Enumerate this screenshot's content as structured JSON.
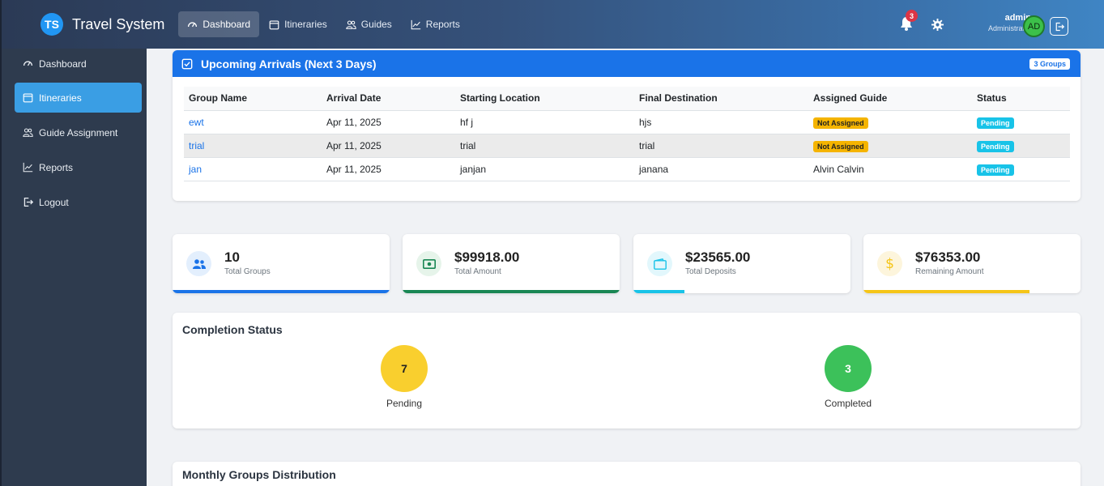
{
  "brand": {
    "logo_text": "TS",
    "name": "Travel System"
  },
  "topnav": [
    {
      "label": "Dashboard",
      "icon": "dashboard-icon",
      "active": true
    },
    {
      "label": "Itineraries",
      "icon": "calendar-icon",
      "active": false
    },
    {
      "label": "Guides",
      "icon": "people-icon",
      "active": false
    },
    {
      "label": "Reports",
      "icon": "chart-icon",
      "active": false
    }
  ],
  "header": {
    "notification_count": "3",
    "user_name": "admin",
    "user_role": "Administrator",
    "avatar_initials": "AD"
  },
  "sidebar": {
    "items": [
      {
        "label": "Dashboard",
        "icon": "dashboard-icon"
      },
      {
        "label": "Itineraries",
        "icon": "calendar-icon",
        "active": true
      },
      {
        "label": "Guide Assignment",
        "icon": "people-icon"
      },
      {
        "label": "Reports",
        "icon": "chart-icon"
      },
      {
        "label": "Logout",
        "icon": "logout-icon"
      }
    ]
  },
  "arrivals": {
    "title": "Upcoming Arrivals (Next 3 Days)",
    "badge": "3 Groups",
    "columns": [
      "Group Name",
      "Arrival Date",
      "Starting Location",
      "Final Destination",
      "Assigned Guide",
      "Status"
    ],
    "rows": [
      {
        "group": "ewt",
        "date": "Apr 11, 2025",
        "start": "hf j",
        "dest": "hjs",
        "guide": "Not Assigned",
        "status": "Pending"
      },
      {
        "group": "trial",
        "date": "Apr 11, 2025",
        "start": "trial",
        "dest": "trial",
        "guide": "Not Assigned",
        "status": "Pending"
      },
      {
        "group": "jan",
        "date": "Apr 11, 2025",
        "start": "janjan",
        "dest": "janana",
        "guide": "Alvin Calvin",
        "status": "Pending"
      }
    ]
  },
  "stats": [
    {
      "value": "10",
      "label": "Total Groups",
      "icon": "people-icon",
      "color": "#1a73e8",
      "progress": 1.0
    },
    {
      "value": "$99918.00",
      "label": "Total Amount",
      "icon": "cash-icon",
      "color": "#198754",
      "progress": 1.0
    },
    {
      "value": "$23565.00",
      "label": "Total Deposits",
      "icon": "wallet-icon",
      "color": "#18c3e8",
      "progress": 0.236
    },
    {
      "value": "$76353.00",
      "label": "Remaining Amount",
      "icon": "dollar-icon",
      "color": "#f5c518",
      "progress": 0.764
    }
  ],
  "completion": {
    "title": "Completion Status",
    "pending": {
      "value": "7",
      "label": "Pending",
      "color": "#f9cf2e"
    },
    "completed": {
      "value": "3",
      "label": "Completed",
      "color": "#3cc15a"
    }
  },
  "monthly": {
    "title": "Monthly Groups Distribution"
  }
}
